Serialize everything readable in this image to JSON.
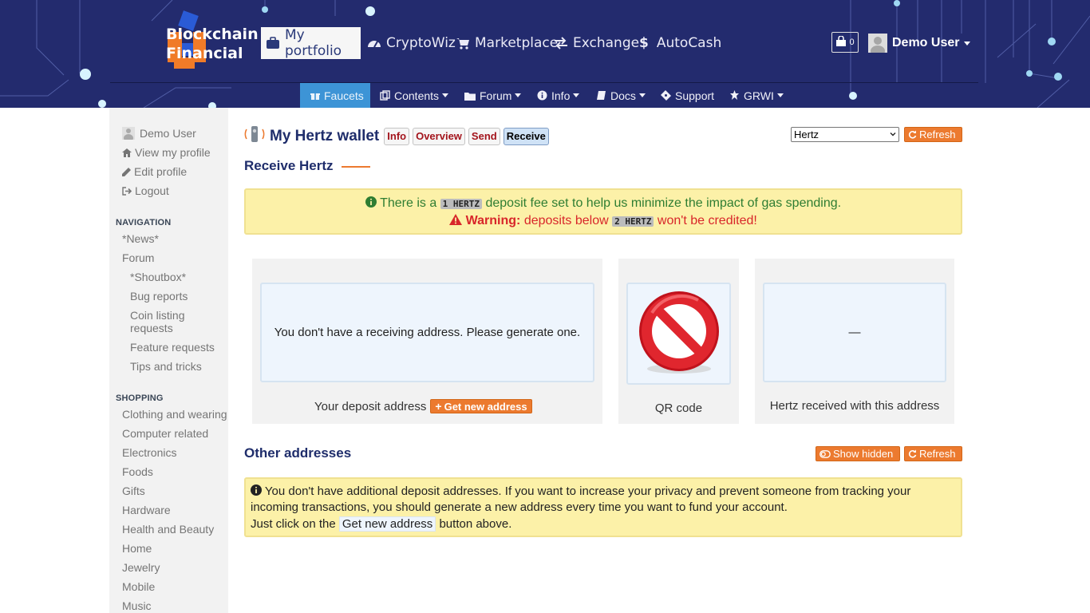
{
  "header": {
    "logo_line1": "Blockchain",
    "logo_line2": "Financial",
    "nav": [
      {
        "label": "My portfolio",
        "icon": "briefcase-icon"
      },
      {
        "label": "CryptoWiz",
        "icon": "gauge-icon"
      },
      {
        "label": "Marketplace",
        "icon": "cart-icon"
      },
      {
        "label": "Exchange",
        "icon": "exchange-icon"
      },
      {
        "label": "AutoCash",
        "icon": "dollar-icon"
      }
    ],
    "cart_count": "0",
    "user": "Demo User",
    "subnav": [
      {
        "label": "Faucets",
        "icon": "gift-icon"
      },
      {
        "label": "Contents",
        "icon": "copy-icon"
      },
      {
        "label": "Forum",
        "icon": "folder-icon"
      },
      {
        "label": "Info",
        "icon": "info-icon"
      },
      {
        "label": "Docs",
        "icon": "book-icon"
      },
      {
        "label": "Support",
        "icon": "ticket-icon"
      },
      {
        "label": "GRWI",
        "icon": "grwi-icon"
      }
    ]
  },
  "sidebar": {
    "user": "Demo User",
    "view_profile": "View my profile",
    "edit_profile": "Edit profile",
    "logout": "Logout",
    "navigation_head": "NAVIGATION",
    "navigation": [
      "*News*",
      "Forum",
      "*Shoutbox*",
      "Bug reports",
      "Coin listing requests",
      "Feature requests",
      "Tips and tricks"
    ],
    "shopping_head": "SHOPPING",
    "shopping": [
      "Clothing and wearing",
      "Computer related",
      "Electronics",
      "Foods",
      "Gifts",
      "Hardware",
      "Health and Beauty",
      "Home",
      "Jewelry",
      "Mobile",
      "Music"
    ]
  },
  "wallet": {
    "title": "My Hertz wallet",
    "tabs": [
      "Info",
      "Overview",
      "Send",
      "Receive"
    ],
    "active_tab": "Receive",
    "currency_selected": "Hertz",
    "refresh": "Refresh"
  },
  "receive": {
    "title": "Receive Hertz",
    "notice_pre": "There is a",
    "fee_code": "1 HERTZ",
    "notice_post": "deposit fee set to help us minimize the impact of gas spending.",
    "warning_label": "Warning:",
    "warning_pre": "deposits below",
    "min_code": "2 HERTZ",
    "warning_post": "won't be credited!",
    "no_address": "You don't have a receiving address. Please generate one.",
    "deposit_caption": "Your deposit address",
    "get_new_address": "Get new address",
    "qr_caption": "QR code",
    "received_value": "—",
    "received_caption": "Hertz received with this address"
  },
  "other": {
    "title": "Other addresses",
    "show_hidden": "Show hidden",
    "refresh": "Refresh",
    "line1": "You don't have additional deposit addresses. If you want to increase your privacy and prevent someone from tracking your incoming transactions, you should generate a new address every time you want to fund your account.",
    "line2_pre": "Just click on the",
    "line2_btn": "Get new address",
    "line2_post": "button above."
  },
  "colors": {
    "header_bg": "#232b6e",
    "accent_orange": "#ec7a2f",
    "active_subnav": "#3d94d6",
    "title_navy": "#1f2d6b"
  }
}
